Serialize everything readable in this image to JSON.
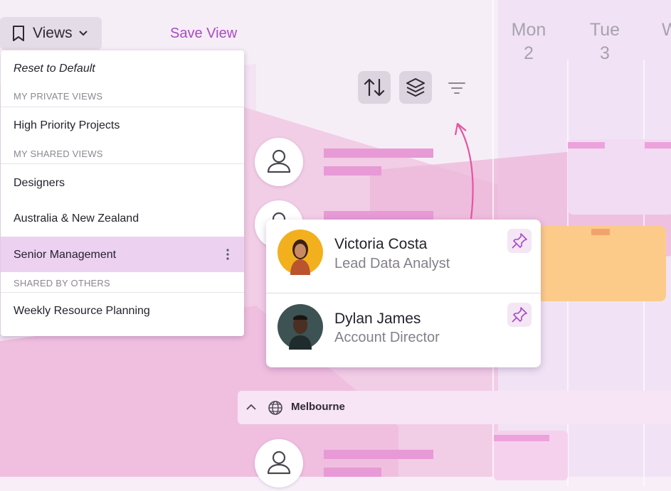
{
  "calendar": {
    "days": [
      {
        "name": "Mon",
        "num": "2"
      },
      {
        "name": "Tue",
        "num": "3"
      },
      {
        "name": "W",
        "num": ""
      }
    ]
  },
  "toolbar": {
    "views_label": "Views",
    "save_view_label": "Save View"
  },
  "dropdown": {
    "reset_label": "Reset to Default",
    "sections": {
      "private": "MY PRIVATE VIEWS",
      "shared": "MY SHARED VIEWS",
      "others": "SHARED BY OTHERS"
    },
    "items": {
      "high_priority": "High Priority Projects",
      "designers": "Designers",
      "anz": "Australia & New Zealand",
      "senior": "Senior Management",
      "weekly": "Weekly Resource Planning"
    }
  },
  "people": [
    {
      "name": "Victoria Costa",
      "role": "Lead Data Analyst"
    },
    {
      "name": "Dylan James",
      "role": "Account Director"
    }
  ],
  "group": {
    "label": "Melbourne"
  },
  "colors": {
    "accent": "#a84bc4",
    "selected_row": "#ecd1f1",
    "bar_pink": "#e79ad6",
    "booking_orange": "#fccb8a"
  },
  "icons": [
    "bookmark-icon",
    "chevron-down-icon",
    "sort-icon",
    "layers-icon",
    "filter-icon",
    "user-icon",
    "pin-icon",
    "chevron-up-icon",
    "globe-icon",
    "more-vertical-icon"
  ]
}
